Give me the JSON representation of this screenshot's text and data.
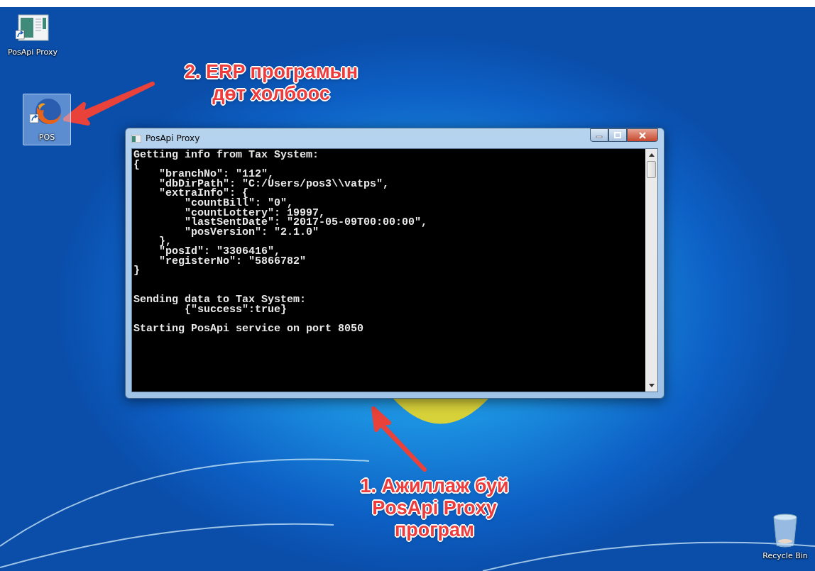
{
  "desktop_icons": [
    {
      "kind": "app",
      "label": "PosApi Proxy",
      "selected": false
    },
    {
      "kind": "browser",
      "label": "POS",
      "selected": true
    },
    {
      "kind": "bin",
      "label": "Recycle Bin",
      "selected": false
    }
  ],
  "window": {
    "title": "PosApi Proxy",
    "console_output": "Getting info from Tax System:\n{\n    \"branchNo\": \"112\",\n    \"dbDirPath\": \"C:/Users/pos3\\\\vatps\",\n    \"extraInfo\": {\n        \"countBill\": \"0\",\n        \"countLottery\": 19997,\n        \"lastSentDate\": \"2017-05-09T00:00:00\",\n        \"posVersion\": \"2.1.0\"\n    },\n    \"posId\": \"3306416\",\n    \"registerNo\": \"5866782\"\n}\n\n\nSending data to Tax System:\n        {\"success\":true}\n\nStarting PosApi service on port 8050"
  },
  "annotations": [
    {
      "kind": "top",
      "text": "2. ERP програмын\nдөт холбоос"
    },
    {
      "kind": "bottom",
      "text": "1. Ажиллаж буй\nPosApi Proxy\nпрограм"
    }
  ]
}
